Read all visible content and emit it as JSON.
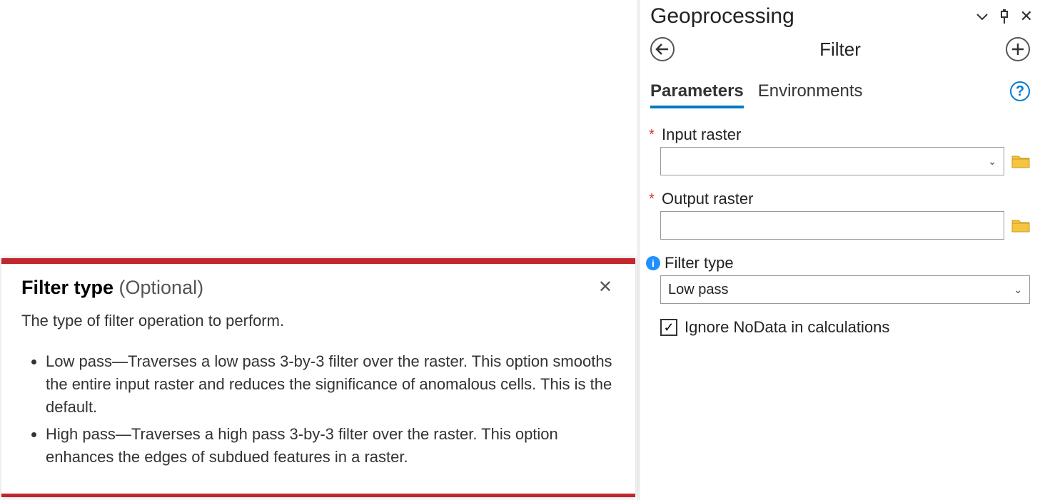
{
  "pane": {
    "title": "Geoprocessing",
    "tool_name": "Filter",
    "tabs": {
      "parameters": "Parameters",
      "environments": "Environments"
    }
  },
  "form": {
    "input_raster": {
      "label": "Input raster",
      "value": "",
      "required": true
    },
    "output_raster": {
      "label": "Output raster",
      "value": "",
      "required": true
    },
    "filter_type": {
      "label": "Filter type",
      "value": "Low pass",
      "has_info": true
    },
    "ignore_nodata": {
      "label": "Ignore NoData in calculations",
      "checked": true
    }
  },
  "tooltip": {
    "title_bold": "Filter type",
    "title_optional": " (Optional)",
    "desc": "The type of filter operation to perform.",
    "items": [
      "Low pass—Traverses a low pass 3-by-3 filter over the raster. This option smooths the entire input raster and reduces the significance of anomalous cells. This is the default.",
      "High pass—Traverses a high pass 3-by-3 filter over the raster. This option enhances the edges of subdued features in a raster."
    ]
  },
  "glyphs": {
    "check": "✓",
    "caret": "⌄",
    "close": "✕",
    "plus": "+",
    "help": "?",
    "info": "i"
  }
}
